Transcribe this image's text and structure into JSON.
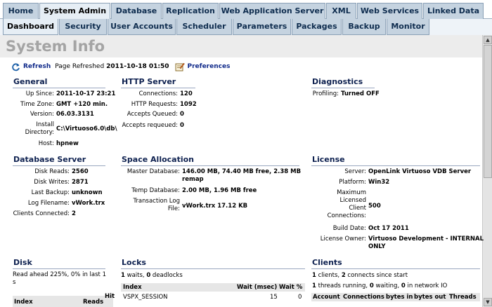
{
  "tabs_top": [
    {
      "label": "Home",
      "active": false
    },
    {
      "label": "System Admin",
      "active": true
    },
    {
      "label": "Database",
      "active": false
    },
    {
      "label": "Replication",
      "active": false
    },
    {
      "label": "Web Application Server",
      "active": false
    },
    {
      "label": "XML",
      "active": false
    },
    {
      "label": "Web Services",
      "active": false
    },
    {
      "label": "Linked Data",
      "active": false
    }
  ],
  "tabs_sub": [
    {
      "label": "Dashboard",
      "active": true
    },
    {
      "label": "Security",
      "active": false
    },
    {
      "label": "User Accounts",
      "active": false
    },
    {
      "label": "Scheduler",
      "active": false
    },
    {
      "label": "Parameters",
      "active": false
    },
    {
      "label": "Packages",
      "active": false
    },
    {
      "label": "Backup",
      "active": false
    },
    {
      "label": "Monitor",
      "active": false
    }
  ],
  "page": {
    "title": "System Info"
  },
  "toolbar": {
    "refresh": "Refresh",
    "refreshed_label": "Page Refreshed",
    "refreshed_value": "2011-10-18 01:50",
    "preferences": "Preferences"
  },
  "general": {
    "title": "General",
    "up_since_label": "Up Since:",
    "up_since": "2011-10-17 23:21",
    "timezone_label": "Time Zone:",
    "timezone": "GMT +120 min.",
    "version_label": "Version:",
    "version": "06.03.3131",
    "install_label_1": "Install",
    "install_label_2": "Directory:",
    "install": "C:\\Virtuoso6.0\\db\\",
    "host_label": "Host:",
    "host": "hpnew"
  },
  "http": {
    "title": "HTTP Server",
    "connections_label": "Connections:",
    "connections": "120",
    "requests_label": "HTTP Requests:",
    "requests": "1092",
    "queued_label": "Accepts Queued:",
    "queued": "0",
    "requeued_label": "Accepts requeued:",
    "requeued": "0"
  },
  "diagnostics": {
    "title": "Diagnostics",
    "profiling_label": "Profiling:",
    "profiling": "Turned OFF"
  },
  "dbserver": {
    "title": "Database Server",
    "disk_reads_label": "Disk Reads:",
    "disk_reads": "2560",
    "disk_writes_label": "Disk Writes:",
    "disk_writes": "2871",
    "last_backup_label": "Last Backup:",
    "last_backup": "unknown",
    "log_label": "Log Filename:",
    "log": "vWork.trx",
    "clients_label": "Clients Connected:",
    "clients": "2"
  },
  "space": {
    "title": "Space Allocation",
    "master_label": "Master Database:",
    "master_1": "146.00 MB, 74.40 MB free, 2.38 MB",
    "master_2": "remap",
    "temp_label": "Temp Database:",
    "temp": "2.00 MB, 1.96 MB free",
    "txlog_label_1": "Transaction Log",
    "txlog_label_2": "File:",
    "txlog": "vWork.trx 17.12 KB"
  },
  "license": {
    "title": "License",
    "server_label": "Server:",
    "server": "OpenLink Virtuoso VDB Server",
    "platform_label": "Platform:",
    "platform": "Win32",
    "maxconn_label_1": "Maximum",
    "maxconn_label_2": "Licensed",
    "maxconn_label_3": "Client",
    "maxconn_label_4": "Connections:",
    "maxconn": "500",
    "build_label": "Build Date:",
    "build": "Oct 17 2011",
    "owner_label": "License Owner:",
    "owner_1": "Virtuoso Development - INTERNAL",
    "owner_2": "ONLY"
  },
  "disk": {
    "title": "Disk",
    "line_1": "Read ahead 225%, 0% in last 1",
    "line_2": "s",
    "col_index": "Index",
    "col_reads": "Reads",
    "col_hit": "Hit"
  },
  "locks": {
    "title": "Locks",
    "waits": "1",
    "waits_text": " waits, ",
    "deadlocks": "0",
    "deadlocks_text": " deadlocks",
    "col_index": "Index",
    "col_wait": "Wait (msec)",
    "col_waitpct": "Wait %",
    "row_index": "VSPX_SESSION",
    "row_wait": "15",
    "row_waitpct": "0"
  },
  "clients": {
    "title": "Clients",
    "clients": "1",
    "clients_text": " clients, ",
    "connects": "2",
    "connects_text": " connects since start",
    "threads": "1",
    "threads_text": " threads running, ",
    "waiting": "0",
    "waiting_text": " waiting, ",
    "netio": "0",
    "netio_text": " in network IO",
    "col_account": "Account",
    "col_connections": "Connections",
    "col_bytes_in": "bytes in",
    "col_bytes_out": "bytes out",
    "col_threads": "Threads"
  },
  "colors": {
    "tab": "#c5d3e0",
    "tab_active": "#e6eef5",
    "section": "#0e2150",
    "link": "#102a8a"
  }
}
